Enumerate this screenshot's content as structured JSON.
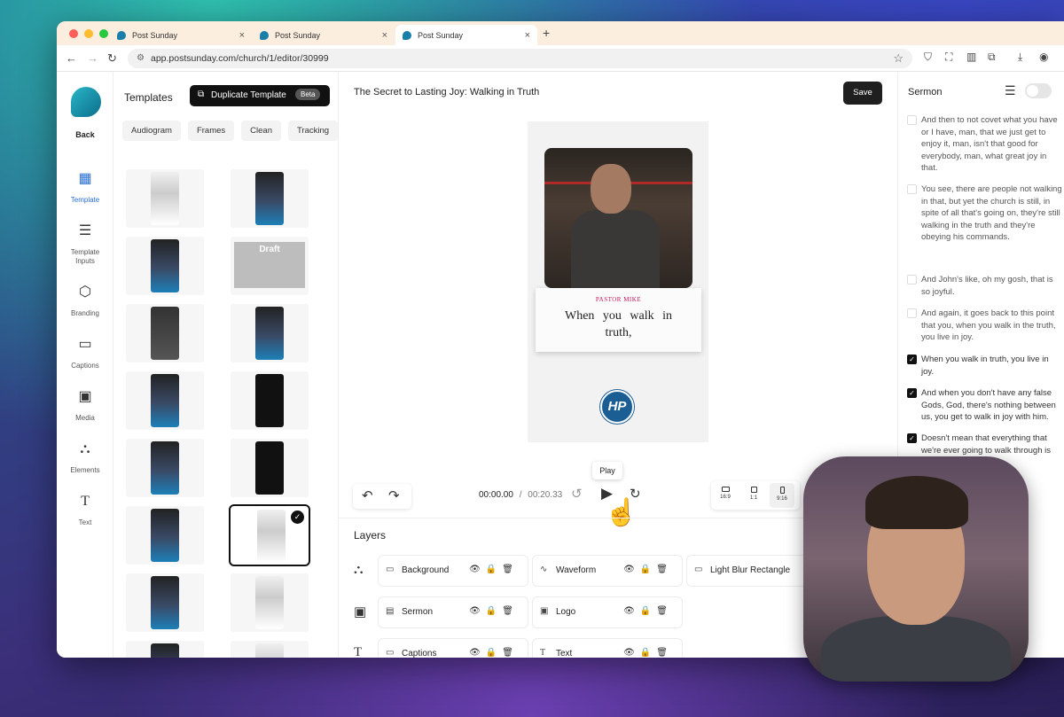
{
  "browser": {
    "tabs": [
      {
        "label": "Post Sunday"
      },
      {
        "label": "Post Sunday"
      },
      {
        "label": "Post Sunday"
      }
    ],
    "url": "app.postsunday.com/church/1/editor/30999"
  },
  "rail": {
    "back_label": "Back",
    "items": [
      {
        "label": "Template",
        "icon": "layout-icon",
        "active": true
      },
      {
        "label": "Template Inputs",
        "icon": "sliders-icon"
      },
      {
        "label": "Branding",
        "icon": "cube-icon"
      },
      {
        "label": "Captions",
        "icon": "caption-icon"
      },
      {
        "label": "Media",
        "icon": "image-icon"
      },
      {
        "label": "Elements",
        "icon": "shapes-icon"
      },
      {
        "label": "Text",
        "icon": "text-icon"
      }
    ]
  },
  "templates": {
    "title": "Templates",
    "duplicate_label": "Duplicate Template",
    "beta_label": "Beta",
    "chips": [
      "Audiogram",
      "Frames",
      "Clean",
      "Tracking"
    ],
    "draft_label": "Draft"
  },
  "editor": {
    "title": "The Secret to Lasting Joy: Walking in Truth",
    "save_label": "Save",
    "caption_name": "PASTOR MIKE",
    "caption_text": "When you walk in truth,",
    "logo_text": "HP",
    "tooltip": "Play",
    "time_current": "00:00.00",
    "time_separator": "/",
    "time_total": "00:20.33",
    "ratios": [
      "16:9",
      "1:1",
      "9:16"
    ],
    "layers_title": "Layers",
    "layers": [
      {
        "label": "Background",
        "icon": "rectangle-icon"
      },
      {
        "label": "Waveform",
        "icon": "waveform-icon"
      },
      {
        "label": "Light Blur Rectangle",
        "icon": "rectangle-icon"
      },
      {
        "label": "Sermon",
        "icon": "video-icon"
      },
      {
        "label": "Logo",
        "icon": "image-icon"
      },
      {
        "label": "Captions",
        "icon": "caption-icon"
      },
      {
        "label": "Text",
        "icon": "text-icon"
      }
    ]
  },
  "sermon": {
    "title": "Sermon",
    "paragraphs": [
      {
        "text": "And then to not covet what you have or I have, man, that we just get to enjoy it, man, isn't that good for everybody, man, what great joy in that.",
        "checked": false
      },
      {
        "text": "You see, there are people not walking in that, but yet the church is still, in spite of all that's going on, they're still walking in the truth and they're obeying his commands.",
        "checked": false
      },
      {
        "text": "And John's like, oh my gosh, that is so joyful.",
        "checked": false
      },
      {
        "text": "And again, it goes back to this point that you, when you walk in the truth, you live in joy.",
        "checked": false
      },
      {
        "text": "When you walk in truth, you live in joy.",
        "checked": true
      },
      {
        "text": "And when you don't have any false Gods, God, there's nothing between us, you get to walk in joy with him.",
        "checked": true
      },
      {
        "text": "Doesn't mean that everything that we're ever going to walk through is going to feel joyful.",
        "checked": true
      }
    ]
  }
}
